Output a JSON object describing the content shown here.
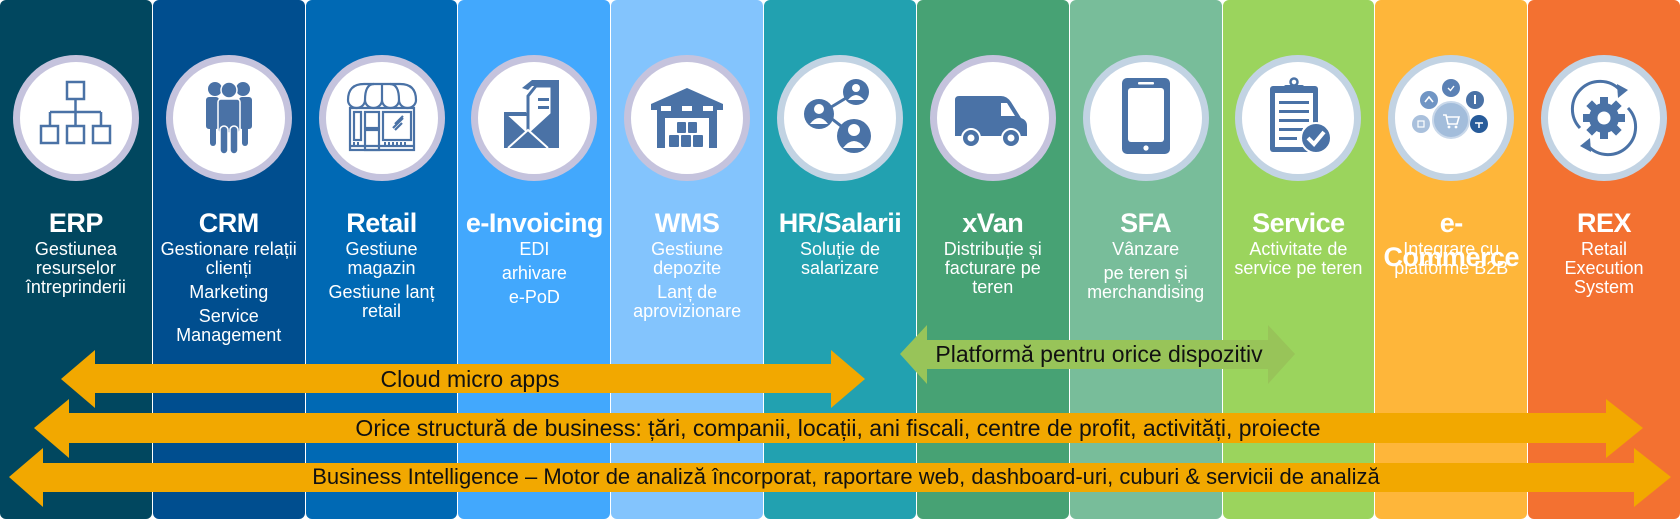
{
  "colors": {
    "icon_blue": "#4a72a6",
    "arrow_orange": "#f2a800",
    "arrow_green": "#98c459"
  },
  "columns": [
    {
      "id": "erp",
      "title": "ERP",
      "icon": "org-chart-icon",
      "bg": "#01475f",
      "ring": "lavender",
      "lines": [
        "Gestiunea",
        "resurselor",
        "întreprinderii"
      ]
    },
    {
      "id": "crm",
      "title": "CRM",
      "icon": "people-group-icon",
      "bg": "#004e8f",
      "ring": "lavender",
      "lines": [
        "Gestionare relații",
        "clienți",
        "|",
        "Marketing",
        "|",
        "Service",
        "Management"
      ]
    },
    {
      "id": "retail",
      "title": "Retail",
      "icon": "storefront-icon",
      "bg": "#0069b4",
      "ring": "lavender",
      "lines": [
        "Gestiune",
        "magazin",
        "|",
        "Gestiune lanț",
        "retail"
      ]
    },
    {
      "id": "e-invoicing",
      "title": "e-Invoicing",
      "icon": "envelope-document-icon",
      "bg": "#42a8fd",
      "ring": "lavender",
      "lines": [
        "EDI",
        "|",
        "arhivare",
        "|",
        "e-PoD"
      ]
    },
    {
      "id": "wms",
      "title": "WMS",
      "icon": "warehouse-icon",
      "bg": "#83c4fd",
      "ring": "lavender",
      "lines": [
        "Gestiune",
        "depozite",
        "|",
        "Lanț de",
        "aprovizionare"
      ]
    },
    {
      "id": "hr-salarii",
      "title": "HR/Salarii",
      "icon": "people-network-icon",
      "bg": "#22a1b0",
      "ring": "blue",
      "lines": [
        "Soluție de",
        "salarizare"
      ]
    },
    {
      "id": "xvan",
      "title": "xVan",
      "icon": "delivery-van-icon",
      "bg": "#47a274",
      "ring": "lavender",
      "lines": [
        "Distribuție și",
        "facturare pe",
        "teren"
      ]
    },
    {
      "id": "sfa",
      "title": "SFA",
      "icon": "tablet-icon",
      "bg": "#78bd9a",
      "ring": "blue",
      "lines": [
        "Vânzare",
        "|",
        "pe teren și",
        "merchandising"
      ]
    },
    {
      "id": "service",
      "title": "Service",
      "icon": "clipboard-check-icon",
      "bg": "#9bd45d",
      "ring": "blue",
      "lines": [
        "Activitate de",
        "service pe teren"
      ]
    },
    {
      "id": "e-commerce",
      "title": "e-Commerce",
      "icon": "shopping-cart-network-icon",
      "bg": "#feb63a",
      "ring": "blue",
      "lines": [
        "Integrare cu",
        "platforme B2B"
      ]
    },
    {
      "id": "rex",
      "title": "REX",
      "icon": "gear-cycle-icon",
      "bg": "#f37131",
      "ring": "blue",
      "lines": [
        "Retail",
        "Execution",
        "System"
      ]
    }
  ],
  "arrows": [
    {
      "id": "cloud-micro-apps",
      "label": "Cloud micro apps",
      "color": "orange"
    },
    {
      "id": "platform-any-device",
      "label": "Platformă pentru orice dispozitiv",
      "color": "green"
    },
    {
      "id": "business-structure",
      "label": "Orice structură de business: țări, companii, locații, ani fiscali, centre de profit, activități, proiecte",
      "color": "orange"
    },
    {
      "id": "business-intelligence",
      "label": "Business Intelligence – Motor de analiză încorporat, raportare web, dashboard-uri, cuburi & servicii de analiză",
      "color": "orange"
    }
  ]
}
